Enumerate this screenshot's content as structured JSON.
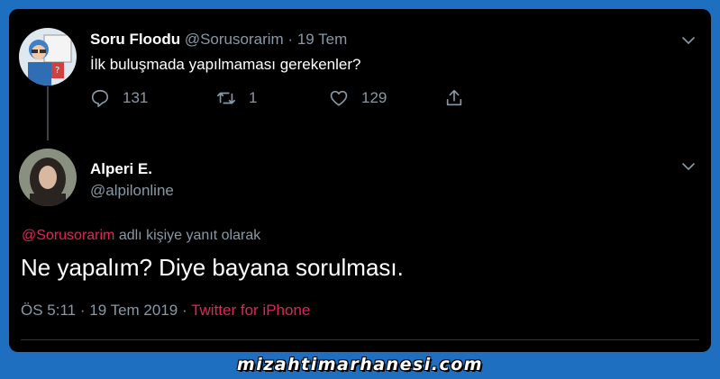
{
  "tweet_original": {
    "display_name": "Soru Floodu",
    "handle": "@Sorusorarim",
    "separator": "·",
    "date": "19 Tem",
    "text": "İlk buluşmada yapılmaması gerekenler?",
    "replies": "131",
    "retweets": "1",
    "likes": "129",
    "avatar_icon": "cartoon-character-avatar"
  },
  "tweet_reply": {
    "display_name": "Alperi E.",
    "handle": "@alpilonline",
    "reply_mention": "@Sorusorarim",
    "reply_suffix": "adlı kişiye yanıt olarak",
    "text": "Ne yapalım? Diye bayana sorulması.",
    "time": "ÖS 5:11",
    "separator": "·",
    "date": "19 Tem 2019",
    "source": "Twitter for iPhone",
    "avatar_icon": "user-photo-avatar"
  },
  "icons": {
    "reply": "reply-icon",
    "retweet": "retweet-icon",
    "like": "heart-icon",
    "share": "share-icon",
    "menu": "chevron-down-icon"
  },
  "colors": {
    "card_background": "#000000",
    "page_background": "#1e6fc0",
    "muted_text": "#8899a6",
    "accent": "#e0245e"
  },
  "watermark": "mizahtimarhanesi.com"
}
